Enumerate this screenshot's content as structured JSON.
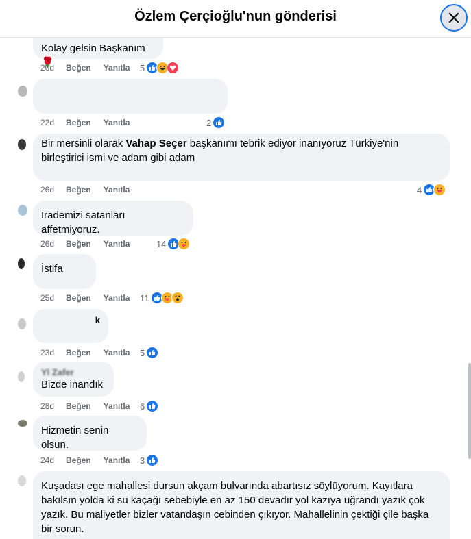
{
  "header": {
    "title": "Özlem Çerçioğlu'nun gönderisi"
  },
  "actions": {
    "like": "Beğen",
    "reply": "Yanıtla"
  },
  "comments": [
    {
      "author": "",
      "text": "Kolay gelsin Başkanım 🌹",
      "time": "20d",
      "count": "5",
      "reactions": [
        "like",
        "haha",
        "love"
      ]
    },
    {
      "author": "",
      "text": "",
      "time": "22d",
      "count": "2",
      "reactions": [
        "like"
      ]
    },
    {
      "author": "",
      "text_pre": "Bir mersinli olarak ",
      "text_bold": "Vahap Seçer",
      "text_post": " başkanımı tebrik ediyor inanıyoruz Türkiye'nin birleştirici ismi ve adam gibi adam",
      "time": "26d",
      "count": "4",
      "reactions": [
        "like",
        "care"
      ]
    },
    {
      "author": "",
      "text": "İrademizi satanları affetmiyoruz.",
      "time": "26d",
      "count": "14",
      "reactions": [
        "like",
        "care"
      ]
    },
    {
      "author": "",
      "text": "İstifa",
      "time": "25d",
      "count": "11",
      "reactions": [
        "like",
        "care",
        "wow"
      ]
    },
    {
      "author": "k",
      "text": "",
      "time": "23d",
      "count": "5",
      "reactions": [
        "like"
      ]
    },
    {
      "author": "Yl Zafer",
      "text": "Bizde inandık",
      "time": "28d",
      "count": "6",
      "reactions": [
        "like"
      ]
    },
    {
      "author": "",
      "text": "Hizmetin senin olsun.",
      "time": "24d",
      "count": "3",
      "reactions": [
        "like"
      ]
    },
    {
      "author": "",
      "text": "Kuşadası ege mahallesi dursun akçam bulvarında abartısız söylüyorum. Kayıtlara bakılsın yolda ki su kaçağı sebebiyle en az 150 devadır yol kazıya uğrandı yazık çok yazık. Bu maliyetler bizler vatandaşın cebinden çıkıyor. Mahallelinin çektiği çile başka bir sorun.",
      "time": "",
      "count": "",
      "reactions": []
    }
  ]
}
